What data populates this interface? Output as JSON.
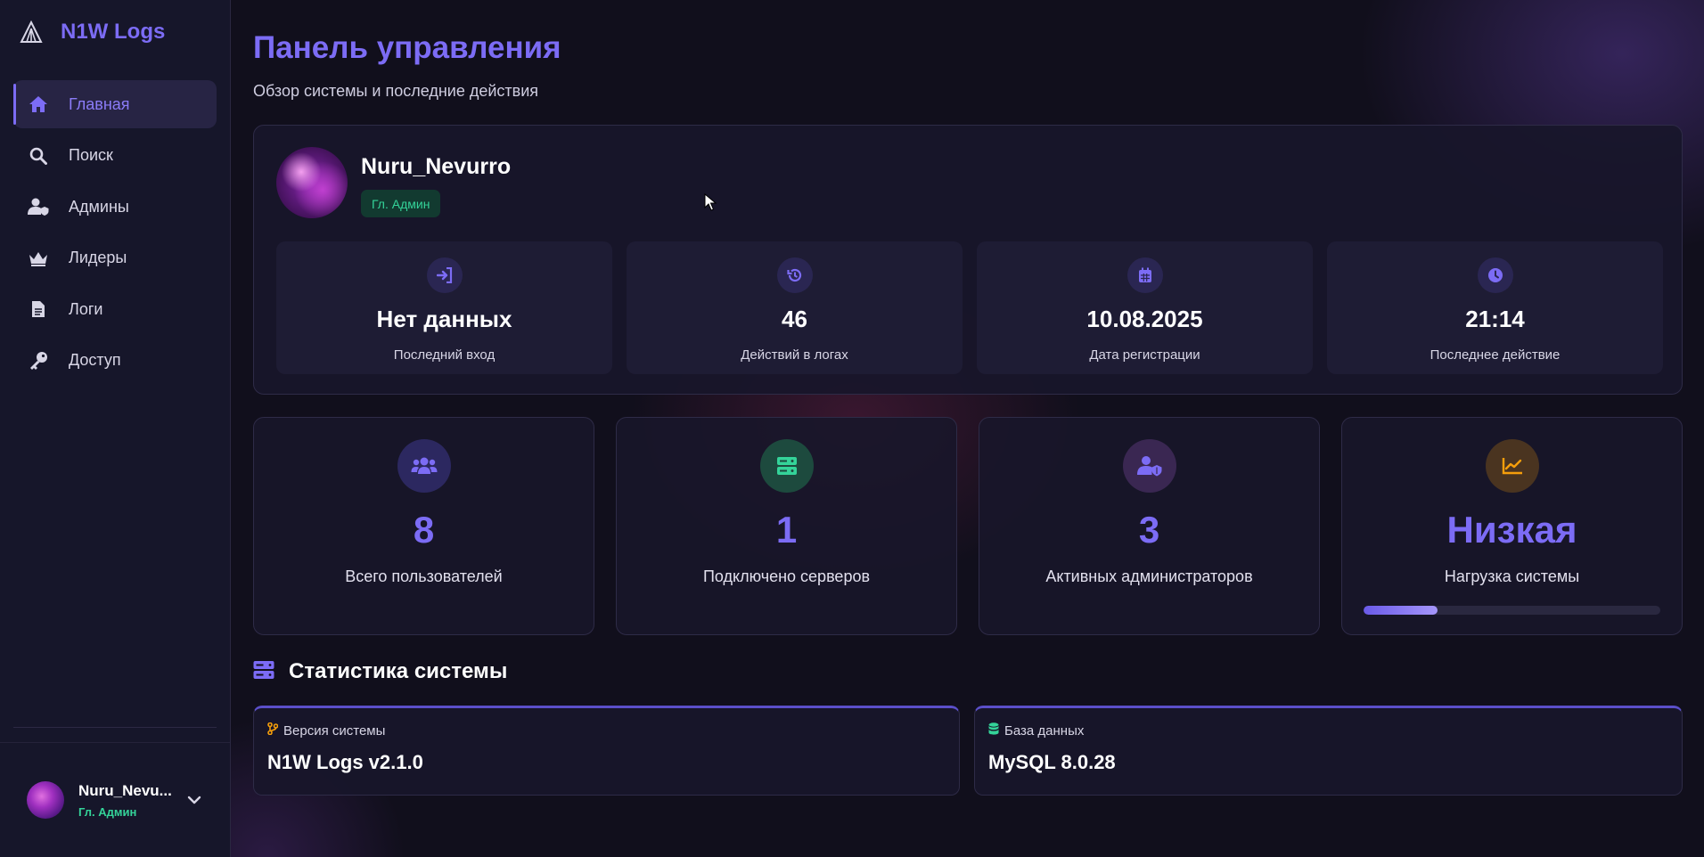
{
  "app": {
    "title": "N1W Logs"
  },
  "sidebar": {
    "items": [
      {
        "label": "Главная",
        "icon": "home-icon",
        "active": true
      },
      {
        "label": "Поиск",
        "icon": "search-icon"
      },
      {
        "label": "Админы",
        "icon": "user-shield-icon"
      },
      {
        "label": "Лидеры",
        "icon": "crown-icon"
      },
      {
        "label": "Логи",
        "icon": "file-icon"
      },
      {
        "label": "Доступ",
        "icon": "key-icon"
      }
    ],
    "user": {
      "name": "Nuru_Nevu...",
      "role": "Гл. Админ"
    }
  },
  "header": {
    "title": "Панель управления",
    "subtitle": "Обзор системы и последние действия"
  },
  "profile": {
    "name": "Nuru_Nevurro",
    "role": "Гл. Админ",
    "stats": [
      {
        "value": "Нет данных",
        "label": "Последний вход",
        "icon": "sign-in-icon"
      },
      {
        "value": "46",
        "label": "Действий в логах",
        "icon": "history-icon"
      },
      {
        "value": "10.08.2025",
        "label": "Дата регистрации",
        "icon": "calendar-icon"
      },
      {
        "value": "21:14",
        "label": "Последнее действие",
        "icon": "clock-icon"
      }
    ]
  },
  "metrics": [
    {
      "value": "8",
      "label": "Всего пользователей",
      "icon": "users-icon",
      "color": "#7c6cf5"
    },
    {
      "value": "1",
      "label": "Подключено серверов",
      "icon": "server-icon",
      "color": "#34d399"
    },
    {
      "value": "3",
      "label": "Активных администраторов",
      "icon": "user-shield-icon",
      "color": "#7c6cf5"
    },
    {
      "value": "Низкая",
      "label": "Нагрузка системы",
      "icon": "chart-line-icon",
      "color": "#f59e0b",
      "load_fraction": 0.25
    }
  ],
  "system_stats": {
    "title": "Статистика системы",
    "version": {
      "label": "Версия системы",
      "value": "N1W Logs v2.1.0"
    },
    "database": {
      "label": "База данных",
      "value": "MySQL 8.0.28"
    }
  },
  "colors": {
    "accent": "#7c6cf5",
    "success": "#34d399",
    "warning": "#f59e0b",
    "background": "#110f1c"
  }
}
